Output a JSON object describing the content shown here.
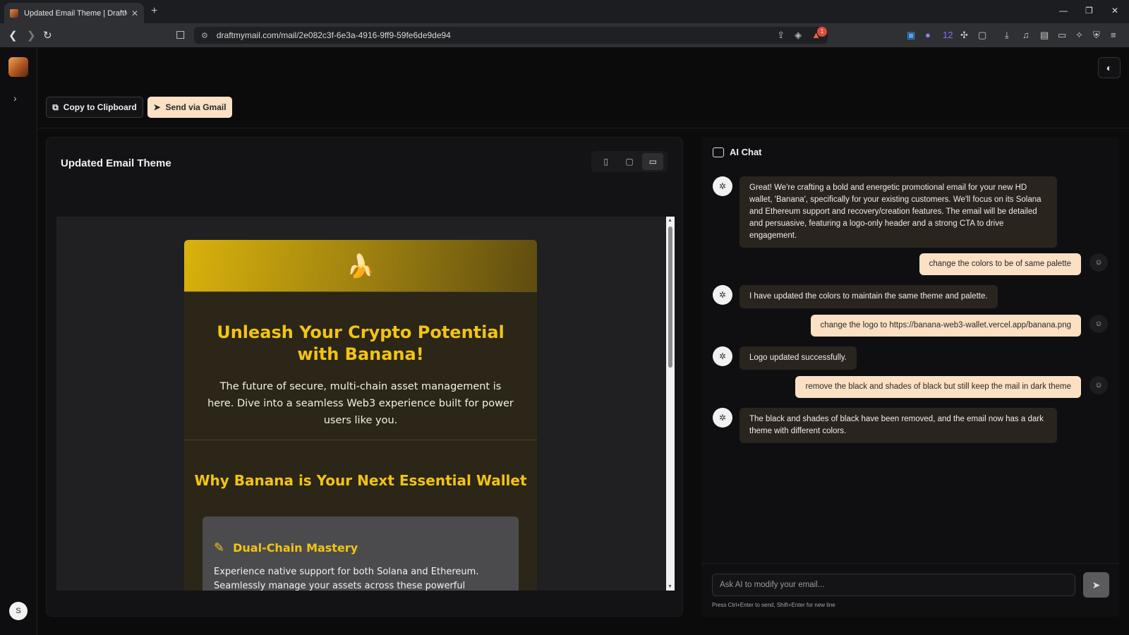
{
  "browser": {
    "tab_title": "Updated Email Theme | DraftMyI",
    "url": "draftmymail.com/mail/2e082c3f-6e3a-4916-9ff9-59fe6de9de94",
    "extension_badge": "12",
    "notification_badge": "1"
  },
  "sidebar": {
    "avatar_initial": "S"
  },
  "actions": {
    "copy_label": "Copy to Clipboard",
    "gmail_label": "Send via Gmail"
  },
  "preview": {
    "title": "Updated Email Theme",
    "email": {
      "logo_glyph": "🍌",
      "headline": "Unleash Your Crypto Potential with Banana!",
      "intro": "The future of secure, multi-chain asset management is here. Dive into a seamless Web3 experience built for power users like you.",
      "section_title": "Why Banana is Your Next Essential Wallet",
      "feature_title": "Dual-Chain Mastery",
      "feature_text": "Experience native support for both Solana and Ethereum. Seamlessly manage your assets across these powerful blockchains from a single"
    }
  },
  "chat": {
    "title": "AI Chat",
    "messages": [
      {
        "role": "bot",
        "text": "Great! We're crafting a bold and energetic promotional email for your new HD wallet, 'Banana', specifically for your existing customers. We'll focus on its Solana and Ethereum support and recovery/creation features. The email will be detailed and persuasive, featuring a logo-only header and a strong CTA to drive engagement."
      },
      {
        "role": "user",
        "text": "change the colors to be of same palette"
      },
      {
        "role": "bot",
        "text": "I have updated the colors to maintain the same theme and palette."
      },
      {
        "role": "user",
        "text": "change the logo to https://banana-web3-wallet.vercel.app/banana.png"
      },
      {
        "role": "bot",
        "text": "Logo updated successfully."
      },
      {
        "role": "user",
        "text": "remove the black and shades of black but still keep the mail in dark theme"
      },
      {
        "role": "bot",
        "text": "The black and shades of black have been removed, and the email now has a dark theme with different colors."
      }
    ],
    "input_placeholder": "Ask AI to modify your email...",
    "hint": "Press Ctrl+Enter to send, Shift+Enter for new line"
  },
  "colors": {
    "accent": "#fbe0c4",
    "email_gold": "#f2c414",
    "email_bg": "#2b2617"
  }
}
